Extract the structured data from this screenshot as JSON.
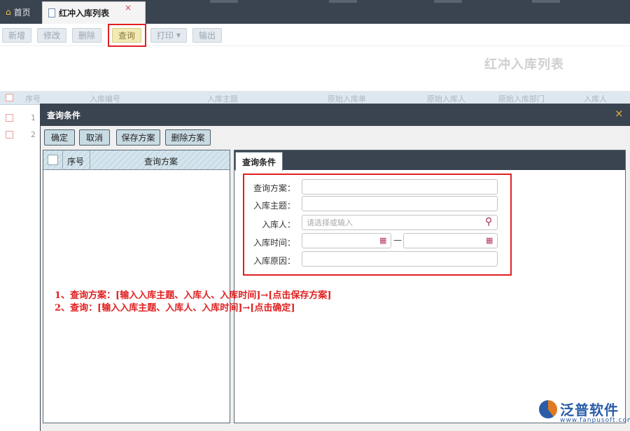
{
  "tabs": {
    "home_label": "首页",
    "active_label": "红冲入库列表",
    "close_glyph": "×"
  },
  "toolbar": {
    "add": "新增",
    "edit": "修改",
    "delete": "删除",
    "query": "查询",
    "print": "打印",
    "print_caret": "▼",
    "export": "输出"
  },
  "page_title": "红冲入库列表",
  "grid": {
    "columns": [
      "序号",
      "入库编号",
      "入库主题",
      "原始入库单",
      "原始入库人",
      "原始入库部门",
      "入库人"
    ],
    "rows": [
      "1",
      "2"
    ]
  },
  "modal": {
    "title": "查询条件",
    "close_glyph": "×",
    "buttons": {
      "confirm": "确定",
      "cancel": "取消",
      "save_plan": "保存方案",
      "delete_plan": "删除方案"
    },
    "left_panel": {
      "col_index": "序号",
      "col_plan": "查询方案"
    },
    "right_panel": {
      "tab_label": "查询条件",
      "fields": {
        "plan_label": "查询方案：",
        "plan_value": "",
        "subject_label": "入库主题：",
        "subject_value": "",
        "person_label": "入库人：",
        "person_placeholder": "请选择或输入",
        "time_label": "入库时间：",
        "time_from": "",
        "time_to": "",
        "time_sep": "—",
        "reason_label": "入库原因：",
        "reason_value": ""
      }
    }
  },
  "annotations": {
    "line1": "1、查询方案：[输入入库主题、入库人、入库时间]→[点击保存方案]",
    "line2": "2、查询：[输入入库主题、入库人、入库时间]→[点击确定]"
  },
  "logo": {
    "text": "泛普软件",
    "url": "www.fanpusoft.com"
  },
  "icons": {
    "home": "home-icon",
    "document": "document-icon",
    "search": "search-icon",
    "calendar": "calendar-icon"
  },
  "colors": {
    "dark_bar": "#3a4450",
    "highlight": "#e02020",
    "query_button": "#f2eab4",
    "brand_blue": "#2a5ca8",
    "brand_orange": "#e07a20"
  }
}
